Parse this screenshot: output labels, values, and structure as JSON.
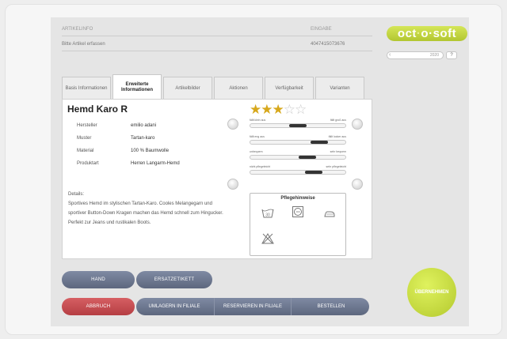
{
  "header": {
    "artikelinfo_label": "ARTIKELINFO",
    "artikelinfo_value": "Bitte Artikel erfassen",
    "eingabe_label": "EINGABE",
    "eingabe_value": "4047415073676"
  },
  "logo": {
    "left": "oct",
    "dot": "·",
    "right": "o·soft"
  },
  "side": {
    "field_value": "2020",
    "help": "?"
  },
  "tabs": [
    {
      "label": "Basis Informationen"
    },
    {
      "label": "Erweiterte Informationen"
    },
    {
      "label": "Artikelbilder"
    },
    {
      "label": "Aktionen"
    },
    {
      "label": "Verfügbarkeit"
    },
    {
      "label": "Varianten"
    }
  ],
  "product": {
    "title": "Hemd Karo R",
    "attributes": [
      {
        "label": "Hersteller",
        "value": "emilio adani"
      },
      {
        "label": "Muster",
        "value": "Tartan-karo"
      },
      {
        "label": "Material",
        "value": "100 % Baumwolle"
      },
      {
        "label": "Produktart",
        "value": "Herren Langarm-Hemd"
      }
    ],
    "details_heading": "Details:",
    "details_text": "Sportives Hemd im stylischen Tartan-Karo. Cooles Melangegarn und sportiver Button-Down Kragen machen das Hemd schnell zum Hingucker. Perfekt zur Jeans und rustikalen Boots.",
    "rating": 3,
    "rating_max": 5
  },
  "sliders": [
    {
      "left": "fällt klein aus",
      "right": "fällt groß aus",
      "value": 0.5
    },
    {
      "left": "fällt eng aus",
      "right": "fällt locker aus",
      "value": 0.78
    },
    {
      "left": "unbequem",
      "right": "sehr bequem",
      "value": 0.62
    },
    {
      "left": "nicht pflegeleicht",
      "right": "sehr pflegeleicht",
      "value": 0.7
    }
  ],
  "care": {
    "title": "Pflegehinweise",
    "icons": [
      "wash-30-icon",
      "tumble-dry-icon",
      "iron-icon",
      "no-bleach-icon"
    ],
    "wash_temp": "30"
  },
  "buttons": {
    "hand": "HAND",
    "ersatzetikett": "ERSATZETIKETT",
    "abbruch": "ABBRUCH",
    "umlagern": "UMLAGERN IN FILIALE",
    "reservieren": "RESERVIEREN IN FILIALE",
    "bestellen": "BESTELLEN",
    "uebernehmen": "ÜBERNEHMEN"
  },
  "colors": {
    "brand_green": "#c2d63c",
    "button_gray": "#6f7991",
    "button_red": "#c44e52",
    "star_gold": "#d7a81c"
  }
}
